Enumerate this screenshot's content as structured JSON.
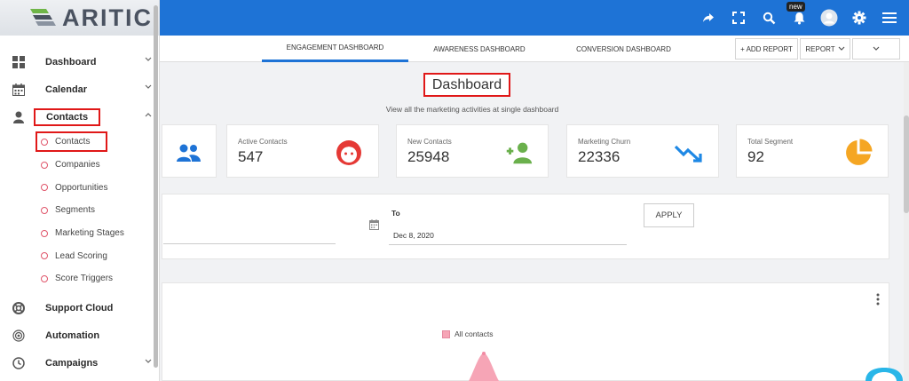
{
  "brand": {
    "name": "ARITIC"
  },
  "topbar": {
    "icons": [
      "share-icon",
      "fullscreen-icon",
      "search-icon",
      "bell-icon",
      "avatar",
      "gear-icon",
      "menu-icon"
    ],
    "badge": "new",
    "color": "#1e73d6"
  },
  "sidebar": {
    "items": [
      {
        "label": "Dashboard",
        "icon": "grid-icon"
      },
      {
        "label": "Calendar",
        "icon": "calendar-icon"
      },
      {
        "label": "Contacts",
        "icon": "user-icon"
      },
      {
        "label": "Support Cloud",
        "icon": "lifebuoy-icon"
      },
      {
        "label": "Automation",
        "icon": "target-icon"
      },
      {
        "label": "Campaigns",
        "icon": "clock-icon"
      }
    ],
    "contacts_sub": [
      "Contacts",
      "Companies",
      "Opportunities",
      "Segments",
      "Marketing Stages",
      "Lead Scoring",
      "Score Triggers"
    ]
  },
  "tabs": [
    {
      "label": "ENGAGEMENT DASHBOARD",
      "active": true
    },
    {
      "label": "AWARENESS DASHBOARD",
      "active": false
    },
    {
      "label": "CONVERSION DASHBOARD",
      "active": false
    }
  ],
  "toolbar": {
    "add_report": "+ ADD REPORT",
    "report": "REPORT"
  },
  "main": {
    "title": "Dashboard",
    "subtitle": "View all the marketing activities at single dashboard"
  },
  "cards": [
    {
      "label": "Active Contacts",
      "value": "547",
      "icon": "face-icon",
      "color": "#e53935"
    },
    {
      "label": "New Contacts",
      "value": "25948",
      "icon": "add-user-icon",
      "color": "#6ab04c"
    },
    {
      "label": "Marketing Churn",
      "value": "22336",
      "icon": "trend-down-icon",
      "color": "#1e88e5"
    },
    {
      "label": "Total Segment",
      "value": "92",
      "icon": "pie-icon",
      "color": "#f5a623"
    }
  ],
  "date_filter": {
    "to_label": "To",
    "to_value": "Dec 8, 2020",
    "apply": "APPLY"
  },
  "chart": {
    "legend": "All contacts",
    "series_color": "#f6a5b6"
  }
}
